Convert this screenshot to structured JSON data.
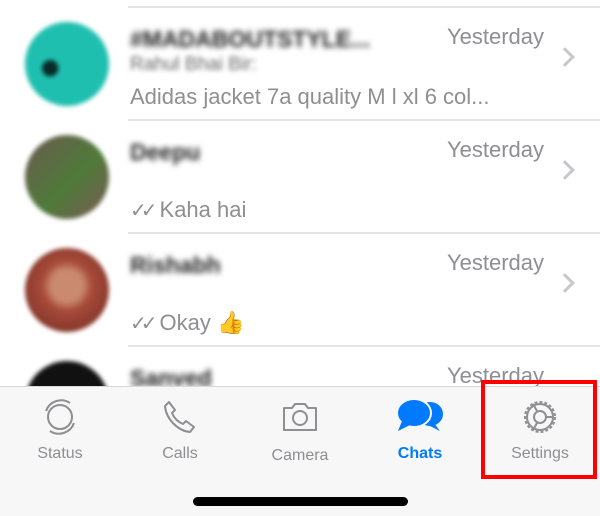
{
  "chats": [
    {
      "name": "#MADABOUTSTYLE...",
      "sender": "Rahul Bhai Bir:",
      "message": "Adidas jacket 7a quality  M l xl 6 col...",
      "time": "Yesterday",
      "read_ticks": false,
      "avatar_color": "#1fbfb0"
    },
    {
      "name": "Deepu",
      "message": "Kaha hai",
      "time": "Yesterday",
      "read_ticks": true,
      "avatar_color": "#5a6a48"
    },
    {
      "name": "Rishabh",
      "message": "Okay 👍",
      "time": "Yesterday",
      "read_ticks": true,
      "avatar_color": "#a84a3a"
    },
    {
      "name": "Sanved",
      "time": "Yesterday",
      "avatar_color": "#111111"
    }
  ],
  "tabs": [
    {
      "label": "Status",
      "icon": "status-icon"
    },
    {
      "label": "Calls",
      "icon": "phone-icon"
    },
    {
      "label": "Camera",
      "icon": "camera-icon"
    },
    {
      "label": "Chats",
      "icon": "chat-bubbles-icon",
      "active": true
    },
    {
      "label": "Settings",
      "icon": "gear-icon",
      "highlighted": true
    }
  ],
  "colors": {
    "active": "#007aff",
    "inactive": "#8e8e93",
    "highlight": "#ff0000"
  },
  "tick_glyph": "✓✓"
}
